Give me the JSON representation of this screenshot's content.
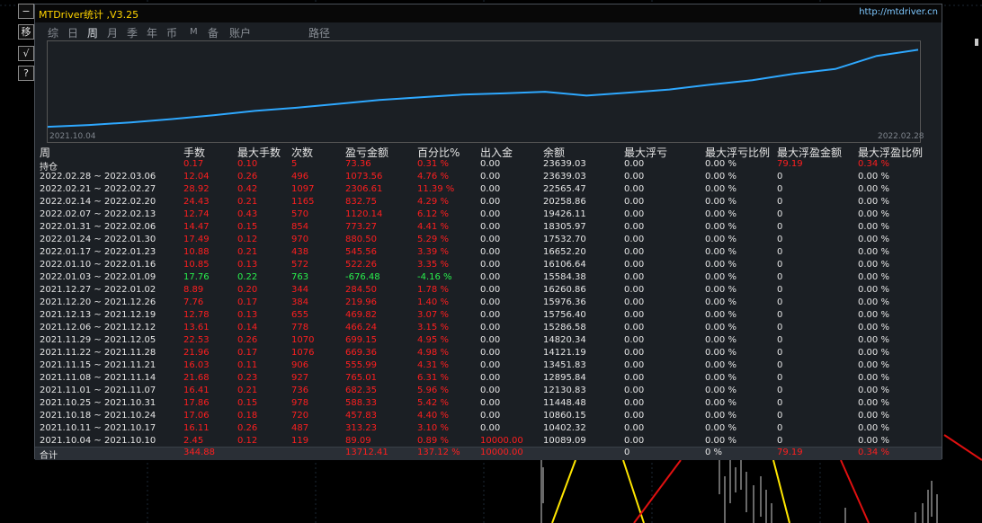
{
  "window": {
    "title": "MTDriver统计 ,V3.25",
    "url": "http://mtdriver.cn",
    "colors": {
      "accent": "#ffd400",
      "positive": "#ff1f1f",
      "negative": "#29f04d",
      "curve": "#2ea8ff"
    }
  },
  "sidebar": [
    {
      "label": "−",
      "icon": "collapse-icon"
    },
    {
      "label": "移",
      "icon": "move-icon"
    },
    {
      "label": "√",
      "icon": "check-icon"
    },
    {
      "label": "?",
      "icon": "help-icon"
    }
  ],
  "tabs": [
    {
      "label": "综"
    },
    {
      "label": "日"
    },
    {
      "label": "周",
      "active": true
    },
    {
      "label": "月"
    },
    {
      "label": "季"
    },
    {
      "label": "年"
    },
    {
      "label": "币"
    },
    {
      "label": "M"
    },
    {
      "label": "备"
    },
    {
      "label": "账户"
    },
    {
      "label": "路径"
    }
  ],
  "chart_data": {
    "type": "line",
    "series": [
      {
        "values": [
          10089.09,
          10402.32,
          10860.15,
          11448.48,
          12130.83,
          12895.84,
          13451.83,
          14121.19,
          14820.34,
          15286.58,
          15756.4,
          15976.36,
          16260.86,
          15584.38,
          16106.64,
          16652.2,
          17532.7,
          18305.97,
          19426.11,
          20258.86,
          22565.47,
          23639.03
        ]
      }
    ],
    "x_start_label": "2021.10.04",
    "x_end_label": "2022.02.28"
  },
  "table": {
    "headers": [
      "周",
      "手数",
      "最大手数",
      "次数",
      "盈亏金额",
      "百分比%",
      "出入金",
      "余额",
      "最大浮亏",
      "最大浮亏比例",
      "最大浮盈金额",
      "最大浮盈比例"
    ],
    "holding": [
      "持仓",
      "0.17",
      "0.10",
      "5",
      "73.36",
      "0.31 %",
      "0.00",
      "23639.03",
      "0.00",
      "0.00 %",
      "79.19",
      "0.34 %"
    ],
    "rows": [
      [
        "2022.02.28 ~ 2022.03.06",
        "12.04",
        "0.26",
        "496",
        "1073.56",
        "4.76 %",
        "0.00",
        "23639.03",
        "0.00",
        "0.00 %",
        "0",
        "0.00 %"
      ],
      [
        "2022.02.21 ~ 2022.02.27",
        "28.92",
        "0.42",
        "1097",
        "2306.61",
        "11.39 %",
        "0.00",
        "22565.47",
        "0.00",
        "0.00 %",
        "0",
        "0.00 %"
      ],
      [
        "2022.02.14 ~ 2022.02.20",
        "24.43",
        "0.21",
        "1165",
        "832.75",
        "4.29 %",
        "0.00",
        "20258.86",
        "0.00",
        "0.00 %",
        "0",
        "0.00 %"
      ],
      [
        "2022.02.07 ~ 2022.02.13",
        "12.74",
        "0.43",
        "570",
        "1120.14",
        "6.12 %",
        "0.00",
        "19426.11",
        "0.00",
        "0.00 %",
        "0",
        "0.00 %"
      ],
      [
        "2022.01.31 ~ 2022.02.06",
        "14.47",
        "0.15",
        "854",
        "773.27",
        "4.41 %",
        "0.00",
        "18305.97",
        "0.00",
        "0.00 %",
        "0",
        "0.00 %"
      ],
      [
        "2022.01.24 ~ 2022.01.30",
        "17.49",
        "0.12",
        "970",
        "880.50",
        "5.29 %",
        "0.00",
        "17532.70",
        "0.00",
        "0.00 %",
        "0",
        "0.00 %"
      ],
      [
        "2022.01.17 ~ 2022.01.23",
        "10.88",
        "0.21",
        "438",
        "545.56",
        "3.39 %",
        "0.00",
        "16652.20",
        "0.00",
        "0.00 %",
        "0",
        "0.00 %"
      ],
      [
        "2022.01.10 ~ 2022.01.16",
        "10.85",
        "0.13",
        "572",
        "522.26",
        "3.35 %",
        "0.00",
        "16106.64",
        "0.00",
        "0.00 %",
        "0",
        "0.00 %"
      ],
      [
        "2022.01.03 ~ 2022.01.09",
        "17.76",
        "0.22",
        "763",
        "-676.48",
        "-4.16 %",
        "0.00",
        "15584.38",
        "0.00",
        "0.00 %",
        "0",
        "0.00 %"
      ],
      [
        "2021.12.27 ~ 2022.01.02",
        "8.89",
        "0.20",
        "344",
        "284.50",
        "1.78 %",
        "0.00",
        "16260.86",
        "0.00",
        "0.00 %",
        "0",
        "0.00 %"
      ],
      [
        "2021.12.20 ~ 2021.12.26",
        "7.76",
        "0.17",
        "384",
        "219.96",
        "1.40 %",
        "0.00",
        "15976.36",
        "0.00",
        "0.00 %",
        "0",
        "0.00 %"
      ],
      [
        "2021.12.13 ~ 2021.12.19",
        "12.78",
        "0.13",
        "655",
        "469.82",
        "3.07 %",
        "0.00",
        "15756.40",
        "0.00",
        "0.00 %",
        "0",
        "0.00 %"
      ],
      [
        "2021.12.06 ~ 2021.12.12",
        "13.61",
        "0.14",
        "778",
        "466.24",
        "3.15 %",
        "0.00",
        "15286.58",
        "0.00",
        "0.00 %",
        "0",
        "0.00 %"
      ],
      [
        "2021.11.29 ~ 2021.12.05",
        "22.53",
        "0.26",
        "1070",
        "699.15",
        "4.95 %",
        "0.00",
        "14820.34",
        "0.00",
        "0.00 %",
        "0",
        "0.00 %"
      ],
      [
        "2021.11.22 ~ 2021.11.28",
        "21.96",
        "0.17",
        "1076",
        "669.36",
        "4.98 %",
        "0.00",
        "14121.19",
        "0.00",
        "0.00 %",
        "0",
        "0.00 %"
      ],
      [
        "2021.11.15 ~ 2021.11.21",
        "16.03",
        "0.11",
        "906",
        "555.99",
        "4.31 %",
        "0.00",
        "13451.83",
        "0.00",
        "0.00 %",
        "0",
        "0.00 %"
      ],
      [
        "2021.11.08 ~ 2021.11.14",
        "21.68",
        "0.23",
        "927",
        "765.01",
        "6.31 %",
        "0.00",
        "12895.84",
        "0.00",
        "0.00 %",
        "0",
        "0.00 %"
      ],
      [
        "2021.11.01 ~ 2021.11.07",
        "16.41",
        "0.21",
        "736",
        "682.35",
        "5.96 %",
        "0.00",
        "12130.83",
        "0.00",
        "0.00 %",
        "0",
        "0.00 %"
      ],
      [
        "2021.10.25 ~ 2021.10.31",
        "17.86",
        "0.15",
        "978",
        "588.33",
        "5.42 %",
        "0.00",
        "11448.48",
        "0.00",
        "0.00 %",
        "0",
        "0.00 %"
      ],
      [
        "2021.10.18 ~ 2021.10.24",
        "17.06",
        "0.18",
        "720",
        "457.83",
        "4.40 %",
        "0.00",
        "10860.15",
        "0.00",
        "0.00 %",
        "0",
        "0.00 %"
      ],
      [
        "2021.10.11 ~ 2021.10.17",
        "16.11",
        "0.26",
        "487",
        "313.23",
        "3.10 %",
        "0.00",
        "10402.32",
        "0.00",
        "0.00 %",
        "0",
        "0.00 %"
      ],
      [
        "2021.10.04 ~ 2021.10.10",
        "2.45",
        "0.12",
        "119",
        "89.09",
        "0.89 %",
        "10000.00",
        "10089.09",
        "0.00",
        "0.00 %",
        "0",
        "0.00 %"
      ]
    ],
    "total": [
      "合计",
      "344.88",
      "",
      "",
      "13712.41",
      "137.12 %",
      "10000.00",
      "",
      "0",
      "0 %",
      "79.19",
      "0.34 %"
    ]
  }
}
